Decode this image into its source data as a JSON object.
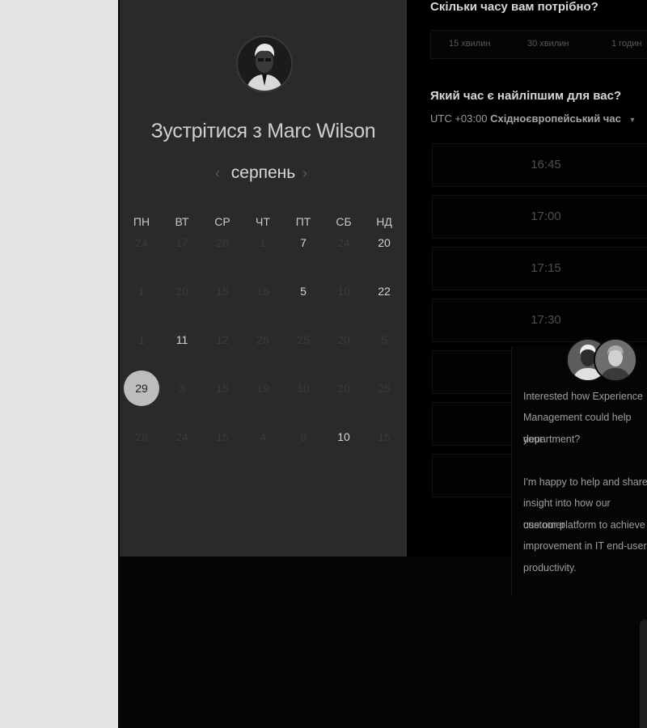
{
  "calendar": {
    "title": "Зустрітися з Marc Wilson",
    "month": "серпень",
    "prev_icon": "‹",
    "next_icon": "›",
    "weekdays": [
      "ПН",
      "ВТ",
      "СР",
      "ЧТ",
      "ПТ",
      "СБ",
      "НД"
    ],
    "rows": [
      [
        {
          "label": "24",
          "state": "disabled"
        },
        {
          "label": "17",
          "state": "disabled"
        },
        {
          "label": "28",
          "state": "disabled"
        },
        {
          "label": "1",
          "state": "disabled"
        },
        {
          "label": "7",
          "state": "available"
        },
        {
          "label": "24",
          "state": "disabled"
        },
        {
          "label": "20",
          "state": "available"
        }
      ],
      [
        {
          "label": "1",
          "state": "disabled"
        },
        {
          "label": "20",
          "state": "disabled"
        },
        {
          "label": "15",
          "state": "disabled"
        },
        {
          "label": "16",
          "state": "disabled"
        },
        {
          "label": "5",
          "state": "available"
        },
        {
          "label": "10",
          "state": "disabled"
        },
        {
          "label": "22",
          "state": "available"
        }
      ],
      [
        {
          "label": "1",
          "state": "disabled"
        },
        {
          "label": "11",
          "state": "available"
        },
        {
          "label": "12",
          "state": "disabled"
        },
        {
          "label": "26",
          "state": "disabled"
        },
        {
          "label": "25",
          "state": "disabled"
        },
        {
          "label": "20",
          "state": "disabled"
        },
        {
          "label": "5",
          "state": "disabled"
        }
      ],
      [
        {
          "label": "29",
          "state": "selected"
        },
        {
          "label": "3",
          "state": "disabled"
        },
        {
          "label": "15",
          "state": "disabled"
        },
        {
          "label": "19",
          "state": "disabled"
        },
        {
          "label": "10",
          "state": "disabled"
        },
        {
          "label": "20",
          "state": "disabled"
        },
        {
          "label": "25",
          "state": "disabled"
        }
      ],
      [
        {
          "label": "28",
          "state": "disabled"
        },
        {
          "label": "24",
          "state": "disabled"
        },
        {
          "label": "15",
          "state": "disabled"
        },
        {
          "label": "4",
          "state": "disabled"
        },
        {
          "label": "9",
          "state": "disabled"
        },
        {
          "label": "10",
          "state": "available"
        },
        {
          "label": "15",
          "state": "disabled"
        }
      ]
    ]
  },
  "duration": {
    "question": "Скільки часу вам потрібно?",
    "options": [
      "15 хвилин",
      "30 хвилин",
      "1 годин"
    ]
  },
  "time": {
    "question": "Який час є найліпшим для вас?",
    "timezone_prefix": "UTC +03:00",
    "timezone_name": "Східноєвропейський час",
    "slots": [
      "16:45",
      "17:00",
      "17:15",
      "17:30",
      "",
      "",
      ""
    ]
  },
  "chat": {
    "lines": [
      "Interested how Experience",
      "Management could help your",
      "department?",
      "",
      "I'm happy to help and share",
      "insight into how our customer",
      "use our platform to achieve",
      "improvement in IT end-user",
      "productivity."
    ]
  },
  "colors": {
    "panel": "#2a2a2a",
    "background": "#000000",
    "selected_day": "#bdbdbd"
  }
}
